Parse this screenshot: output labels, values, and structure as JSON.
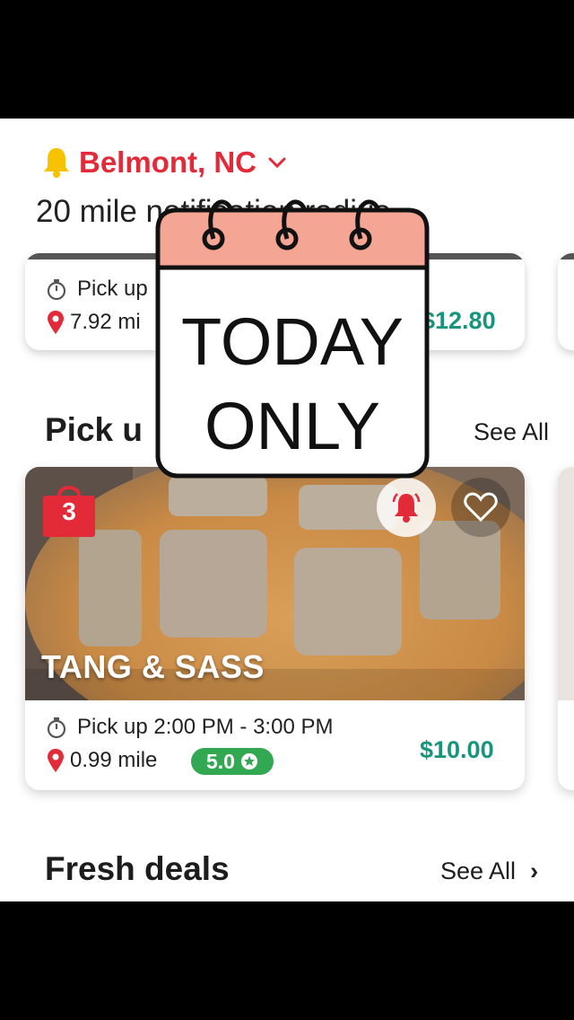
{
  "location": {
    "city": "Belmont, NC",
    "radius_text": "20 mile notification radius"
  },
  "top_card": {
    "pickup": "Pick up",
    "distance": "7.92 mi",
    "price": "$12.80"
  },
  "pickup_section": {
    "title": "Pick u",
    "see_all": "See All"
  },
  "main_card": {
    "bag_count": "3",
    "store_name": "TANG & SASS",
    "pickup": "Pick up 2:00 PM - 3:00 PM",
    "distance": "0.99 mile",
    "rating": "5.0",
    "price": "$10.00"
  },
  "fresh_section": {
    "title": "Fresh deals",
    "see_all": "See All",
    "chevron": "›"
  },
  "sticker": {
    "line1": "TODAY",
    "line2": "ONLY"
  },
  "colors": {
    "red": "#e22a39",
    "green": "#17957c",
    "rating_green": "#32a852",
    "yellow": "#f7c300",
    "sticker_pink": "#f4a594"
  },
  "icons": [
    "bell-icon",
    "chevron-down-icon",
    "stopwatch-icon",
    "pin-icon",
    "shopping-bag-icon",
    "notification-bell-icon",
    "heart-icon",
    "star-icon",
    "chevron-right-icon",
    "calendar-sticker"
  ]
}
